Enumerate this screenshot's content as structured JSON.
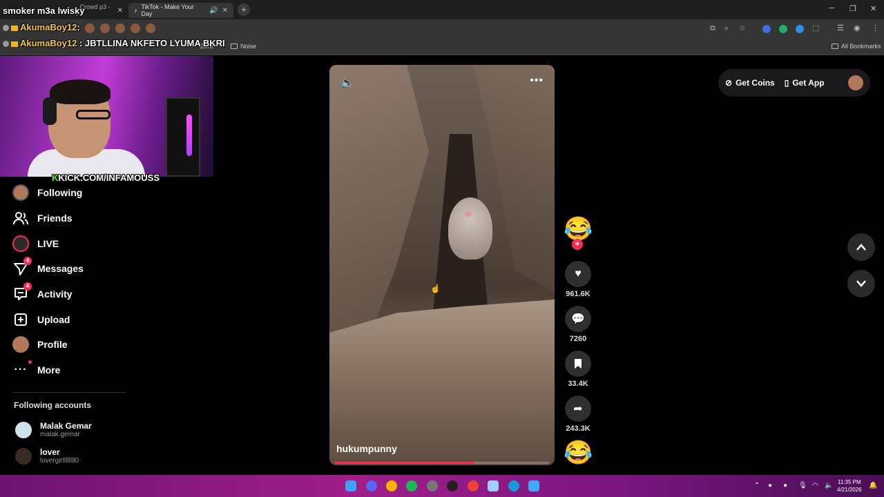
{
  "browser": {
    "tabs": [
      {
        "label": "...Crowd p3 - Y"
      },
      {
        "label": "TikTok - Make Your Day",
        "active": true
      }
    ],
    "new_tab": "+",
    "bookmarks": [
      {
        "label": "Zero"
      },
      {
        "label": "Noise"
      },
      {
        "label": "All Bookmarks"
      }
    ]
  },
  "chat": [
    {
      "user": "",
      "message": "smoker m3a lwisky"
    },
    {
      "user": "AkumaBoy12",
      "message": ":"
    },
    {
      "user": "AkumaBoy12",
      "message": " : JBTLLINA NKFETO LYUMA BKRI"
    }
  ],
  "stream": {
    "kick_prefix": "K",
    "kick_url": "KICK.COM/INFAMOUSS"
  },
  "sidebar": {
    "items": [
      {
        "label": "Following"
      },
      {
        "label": "Friends"
      },
      {
        "label": "LIVE"
      },
      {
        "label": "Messages",
        "badge": "4"
      },
      {
        "label": "Activity",
        "badge": "4"
      },
      {
        "label": "Upload"
      },
      {
        "label": "Profile"
      },
      {
        "label": "More"
      }
    ],
    "following_title": "Following accounts",
    "following": [
      {
        "name": "Malak Gemar",
        "handle": "malak.gemar"
      },
      {
        "name": "lover",
        "handle": "lovergirllllllll0"
      }
    ]
  },
  "video": {
    "author": "hukumpunny",
    "progress": 0.65,
    "sound_icon": "🔈",
    "more_icon": "•••"
  },
  "actions": {
    "likes": "961.6K",
    "comments": "7260",
    "saves": "33.4K",
    "shares": "243.3K",
    "creator_emoji": "😂",
    "sound_emoji": "😂",
    "follow_plus": "+"
  },
  "topbar": {
    "get_coins": "Get Coins",
    "get_app": "Get App"
  },
  "taskbar": {
    "time": "11:35 PM",
    "date": "4/21/2026"
  },
  "colors": {
    "accent": "#fe2c55",
    "kick_green": "#53fc18",
    "chat_user": "#f7c948"
  }
}
